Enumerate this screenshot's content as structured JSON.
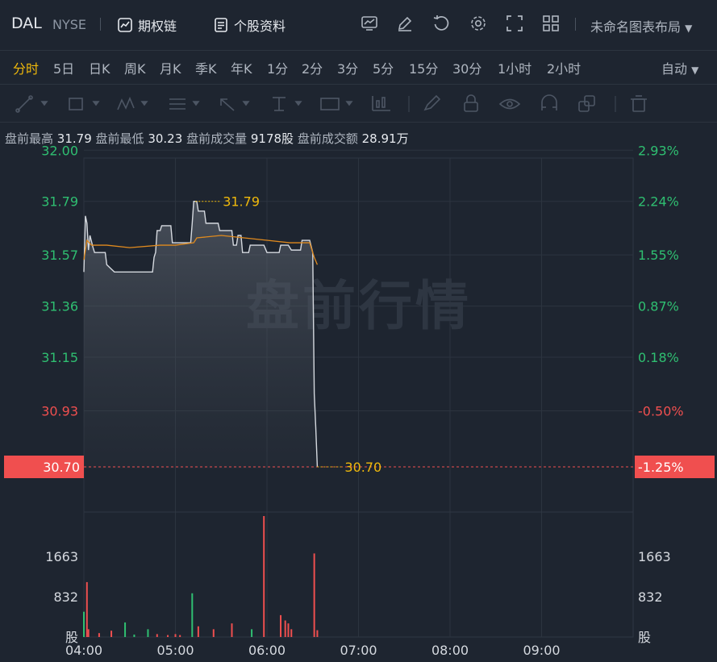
{
  "header": {
    "ticker": "DAL",
    "exchange": "NYSE",
    "option_chain_label": "期权链",
    "stock_info_label": "个股资料",
    "layout_label": "未命名图表布局"
  },
  "periods": [
    "分时",
    "5日",
    "日K",
    "周K",
    "月K",
    "季K",
    "年K",
    "1分",
    "2分",
    "3分",
    "5分",
    "15分",
    "30分",
    "1小时",
    "2小时"
  ],
  "active_period": "分时",
  "auto_label": "自动",
  "stats": {
    "high_label": "盘前最高",
    "high": "31.79",
    "low_label": "盘前最低",
    "low": "30.23",
    "vol_label": "盘前成交量",
    "vol": "9178股",
    "amt_label": "盘前成交额",
    "amt": "28.91万"
  },
  "watermark": "盘前行情",
  "icons": [
    "chart-panel-icon",
    "edit-icon",
    "reset-icon",
    "settings-icon",
    "fullscreen-icon",
    "layout-grid-icon"
  ],
  "draw_tools": [
    "line-tool-icon",
    "rect-tool-icon",
    "pattern-tool-icon",
    "fib-tool-icon",
    "arrow-tool-icon",
    "measure-tool-icon",
    "text-tool-icon",
    "bar-tool-icon",
    "brush-tool-icon",
    "lock-icon",
    "eye-icon",
    "magnet-icon",
    "copy-icon",
    "trash-icon"
  ],
  "colors": {
    "up": "#ef4f4f",
    "down": "#2fbf71",
    "price_line": "#d5d9df",
    "avg_line": "#e08a1e",
    "accent": "#f0b90b",
    "current_bg": "#f04f4f"
  },
  "chart_data": {
    "type": "line",
    "x_ticks": [
      "04:00",
      "05:00",
      "06:00",
      "07:00",
      "08:00",
      "09:00"
    ],
    "y_ticks": [
      "32.00",
      "31.79",
      "31.57",
      "31.36",
      "31.15",
      "30.93"
    ],
    "pct_ticks": [
      "2.93%",
      "2.24%",
      "1.55%",
      "0.87%",
      "0.18%",
      "-0.50%"
    ],
    "ylim": [
      30.7,
      32.12
    ],
    "current_price": "30.70",
    "current_pct": "-1.25%",
    "high_marker": "31.79",
    "low_marker": "30.70",
    "price_series": {
      "name": "",
      "points": [
        [
          "04:00",
          31.5
        ],
        [
          "04:01",
          31.73
        ],
        [
          "04:02",
          31.7
        ],
        [
          "04:03",
          31.59
        ],
        [
          "04:04",
          31.65
        ],
        [
          "04:06",
          31.6
        ],
        [
          "04:07",
          31.58
        ],
        [
          "04:14",
          31.58
        ],
        [
          "04:15",
          31.53
        ],
        [
          "04:20",
          31.5
        ],
        [
          "04:45",
          31.5
        ],
        [
          "04:46",
          31.56
        ],
        [
          "04:47",
          31.58
        ],
        [
          "04:48",
          31.67
        ],
        [
          "04:50",
          31.67
        ],
        [
          "04:51",
          31.69
        ],
        [
          "04:57",
          31.69
        ],
        [
          "04:58",
          31.62
        ],
        [
          "05:10",
          31.62
        ],
        [
          "05:11",
          31.7
        ],
        [
          "05:12",
          31.79
        ],
        [
          "05:14",
          31.79
        ],
        [
          "05:15",
          31.75
        ],
        [
          "05:19",
          31.75
        ],
        [
          "05:20",
          31.7
        ],
        [
          "05:28",
          31.7
        ],
        [
          "05:29",
          31.67
        ],
        [
          "05:37",
          31.67
        ],
        [
          "05:38",
          31.61
        ],
        [
          "05:40",
          31.61
        ],
        [
          "05:41",
          31.65
        ],
        [
          "05:43",
          31.65
        ],
        [
          "05:44",
          31.58
        ],
        [
          "05:48",
          31.58
        ],
        [
          "05:49",
          31.61
        ],
        [
          "05:58",
          31.61
        ],
        [
          "06:00",
          31.58
        ],
        [
          "06:08",
          31.58
        ],
        [
          "06:09",
          31.61
        ],
        [
          "06:14",
          31.61
        ],
        [
          "06:16",
          31.59
        ],
        [
          "06:22",
          31.59
        ],
        [
          "06:23",
          31.63
        ],
        [
          "06:28",
          31.63
        ],
        [
          "06:30",
          31.58
        ],
        [
          "06:31",
          31.0
        ],
        [
          "06:32",
          30.86
        ],
        [
          "06:33",
          30.7
        ]
      ]
    },
    "avg_series": {
      "name": "",
      "points": [
        [
          "04:00",
          31.55
        ],
        [
          "04:02",
          31.63
        ],
        [
          "04:05",
          31.61
        ],
        [
          "04:15",
          31.61
        ],
        [
          "04:30",
          31.6
        ],
        [
          "04:50",
          31.61
        ],
        [
          "05:00",
          31.61
        ],
        [
          "05:12",
          31.62
        ],
        [
          "05:14",
          31.64
        ],
        [
          "05:30",
          31.65
        ],
        [
          "05:45",
          31.64
        ],
        [
          "06:00",
          31.63
        ],
        [
          "06:15",
          31.62
        ],
        [
          "06:28",
          31.62
        ],
        [
          "06:31",
          31.56
        ],
        [
          "06:33",
          31.53
        ]
      ]
    },
    "volume_ticks": [
      "1663",
      "832",
      "股"
    ],
    "volume_max": 2490,
    "volume_bars": [
      [
        "04:00",
        520,
        "down"
      ],
      [
        "04:02",
        1130,
        "up"
      ],
      [
        "04:03",
        160,
        "up"
      ],
      [
        "04:10",
        80,
        "up"
      ],
      [
        "04:18",
        130,
        "up"
      ],
      [
        "04:27",
        300,
        "down"
      ],
      [
        "04:33",
        50,
        "down"
      ],
      [
        "04:42",
        160,
        "down"
      ],
      [
        "04:48",
        60,
        "up"
      ],
      [
        "04:55",
        40,
        "up"
      ],
      [
        "05:00",
        60,
        "up"
      ],
      [
        "05:03",
        40,
        "up"
      ],
      [
        "05:11",
        900,
        "down"
      ],
      [
        "05:15",
        220,
        "up"
      ],
      [
        "05:25",
        160,
        "up"
      ],
      [
        "05:37",
        280,
        "up"
      ],
      [
        "05:50",
        160,
        "down"
      ],
      [
        "05:58",
        2490,
        "up"
      ],
      [
        "06:09",
        450,
        "up"
      ],
      [
        "06:12",
        340,
        "up"
      ],
      [
        "06:14",
        280,
        "up"
      ],
      [
        "06:16",
        160,
        "up"
      ],
      [
        "06:31",
        1720,
        "up"
      ],
      [
        "06:33",
        140,
        "up"
      ]
    ]
  }
}
